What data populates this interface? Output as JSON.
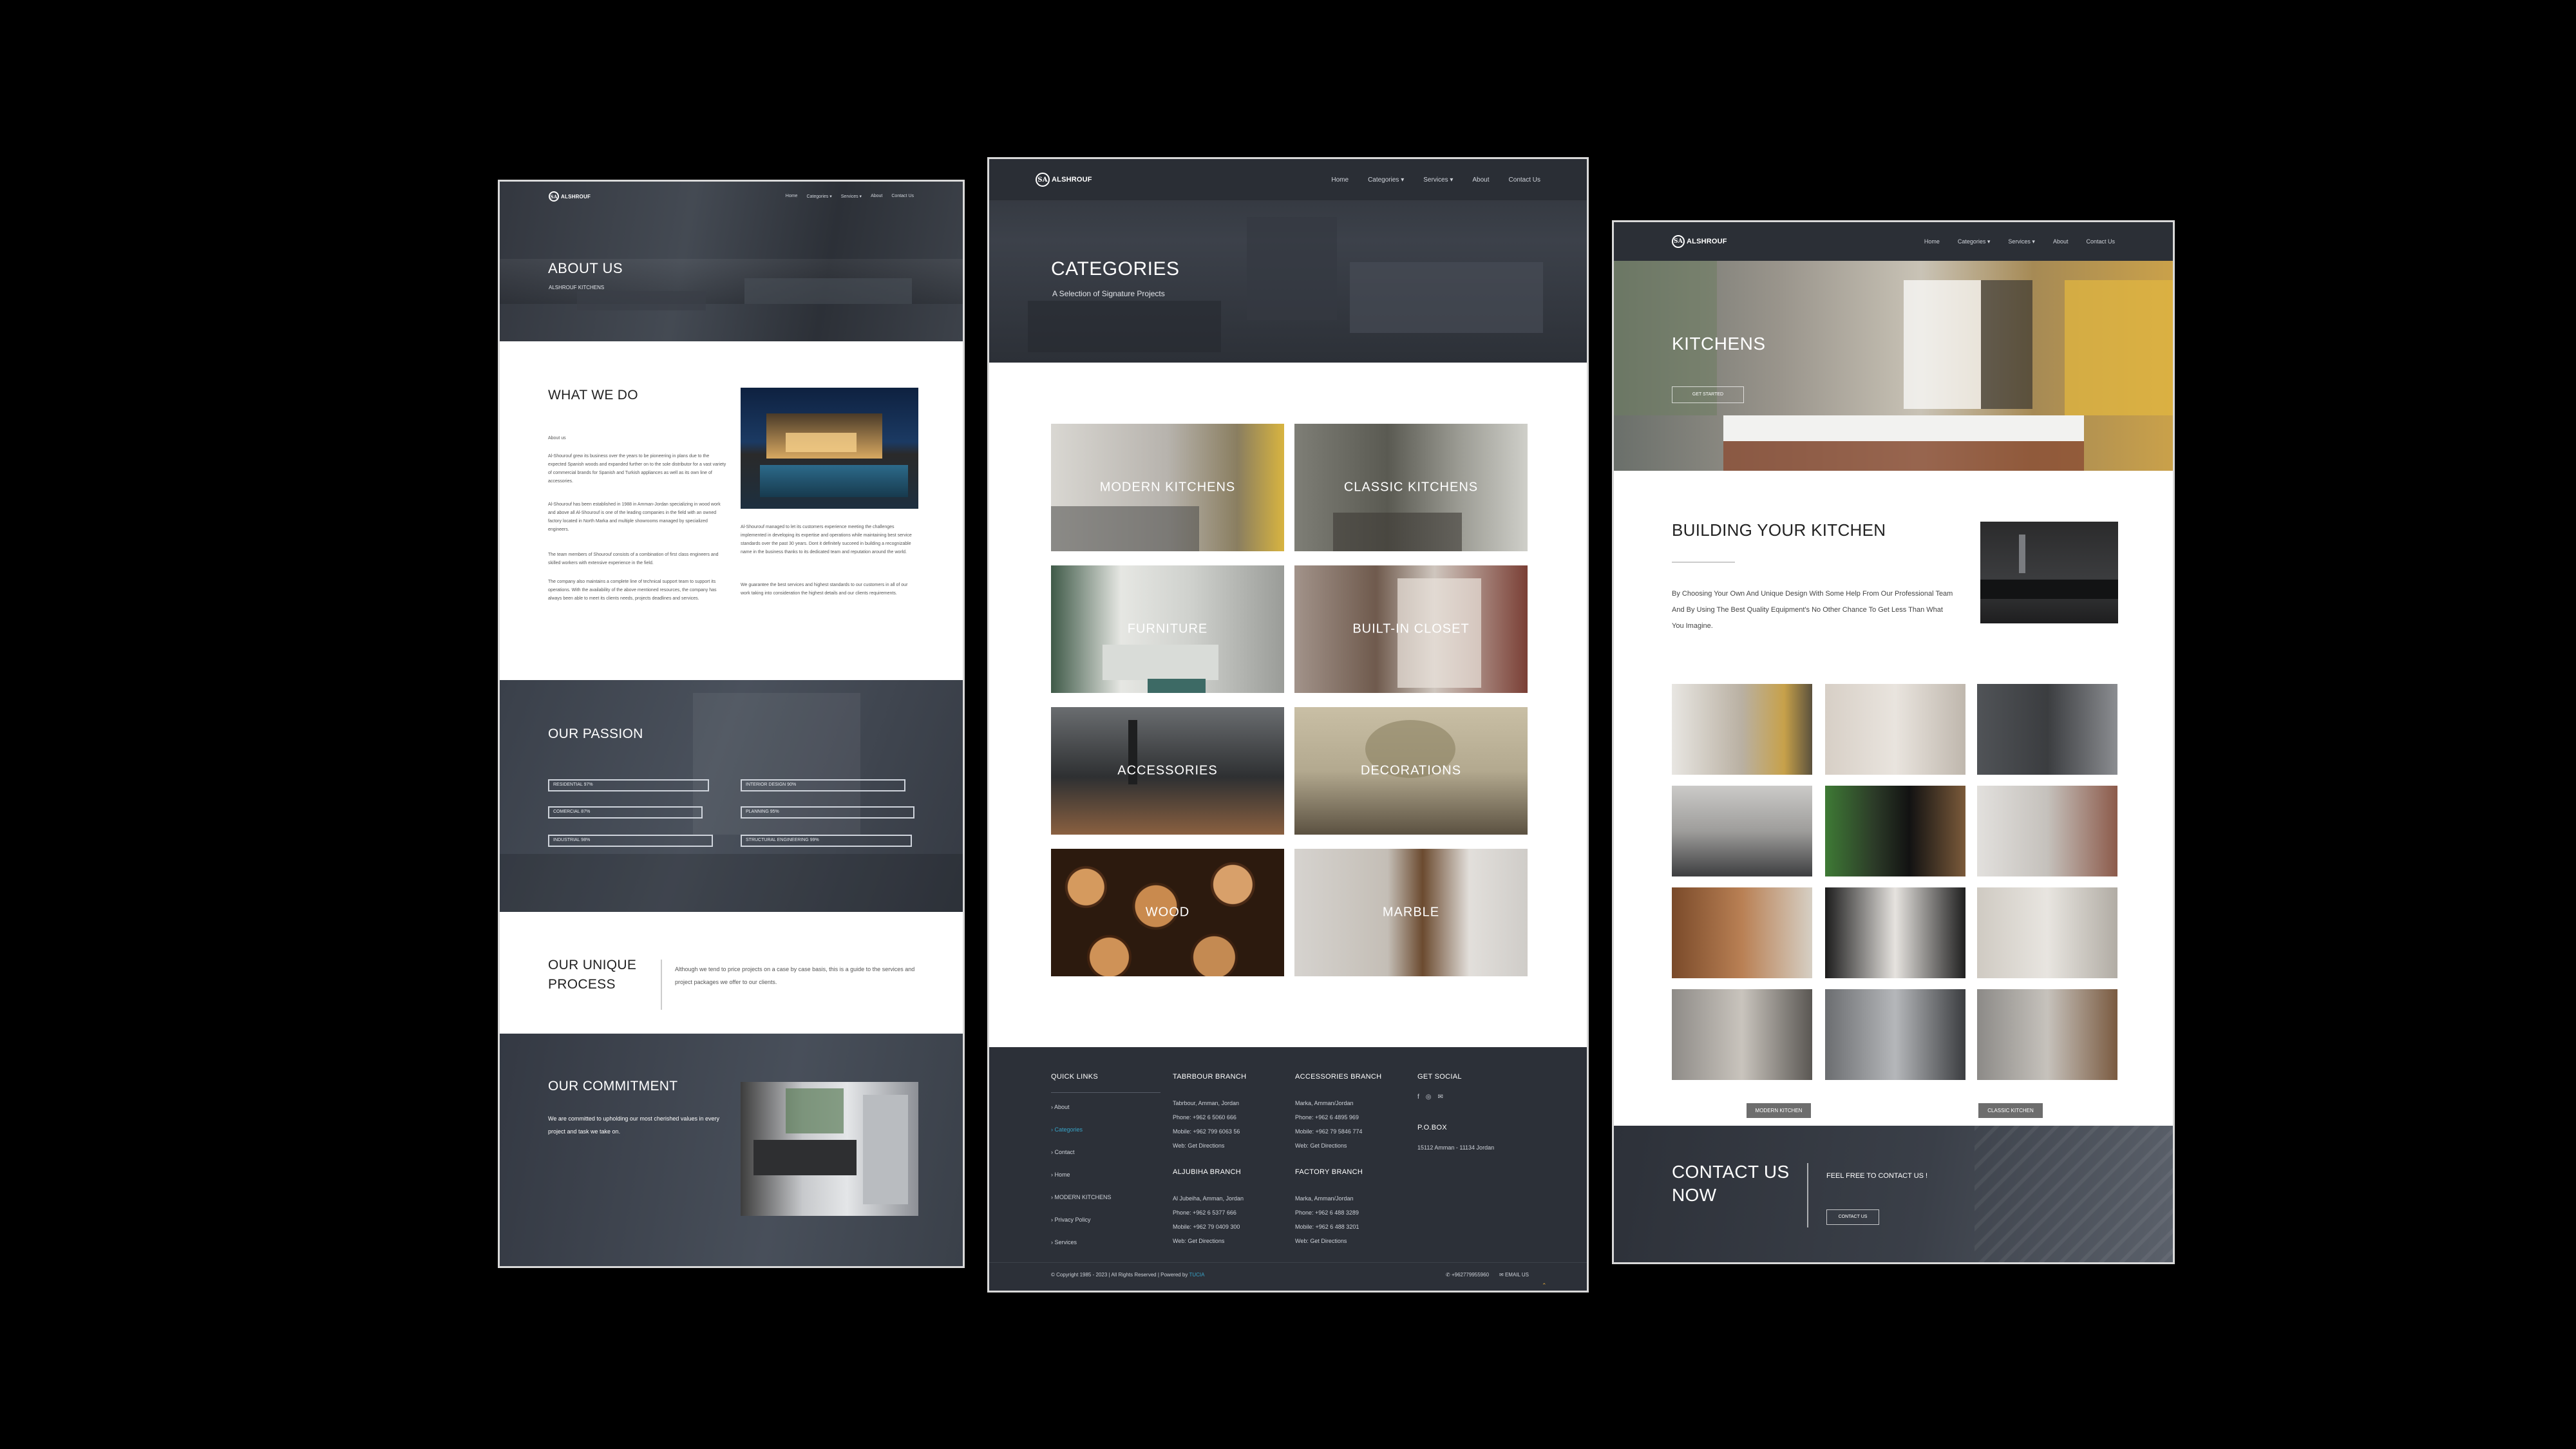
{
  "brand": {
    "logo_mark": "SA",
    "logo_text": "ALSHROUF"
  },
  "nav_small": [
    "Home",
    "Categories ▾",
    "Services ▾",
    "About",
    "Contact Us"
  ],
  "about_page": {
    "hero_title": "ABOUT US",
    "hero_sub": "ALSHROUF KITCHENS",
    "what_we_do": "WHAT WE DO",
    "about_label": "About us",
    "para1": "Al-Shourouf grew its business over the years to be pioneering in plans due to the expected Spanish woods and expanded further on to the sole distributor for a vast variety of commercial brands for Spanish and Turkish appliances as well as its own line of accessories.",
    "para2": "Al-Shourouf has been established in 1988 in Amman-Jordan specializing in wood work and above all Al-Shourouf is one of the leading companies in the field with an owned factory located in North Marka and multiple showrooms managed by specialized engineers.",
    "para3": "The team members of Shourouf consists of a combination of first class engineers and skilled workers with extensive experience in the field.",
    "para4": "The company also maintains a complete line of technical support team to support its operations. With the availability of the above mentioned resources, the company has always been able to meet its clients needs, projects deadlines and services.",
    "para5": "Al-Shourouf managed to let its customers experience meeting the challenges implemented in developing its expertise and operations while maintaining best service standards over the past 30 years. Dont it definitely succeed in building a recognizable name in the business thanks to its dedicated team and reputation around the world.",
    "para6": "We guarantee the best services and highest standards to our customers in all of our work taking into consideration the highest details and our clients requirements.",
    "passion_title": "OUR PASSION",
    "passion_bars": [
      {
        "label": "RESIDENTIAL 97%",
        "value": 97
      },
      {
        "label": "INTERIOR DESIGN 90%",
        "value": 90
      },
      {
        "label": "COMERCIAL 87%",
        "value": 87
      },
      {
        "label": "PLANNING 95%",
        "value": 95
      },
      {
        "label": "INDUSTRIAL 98%",
        "value": 98
      },
      {
        "label": "STRUCTURAL ENGINEERING 99%",
        "value": 99
      }
    ],
    "unique_title_1": "OUR UNIQUE",
    "unique_title_2": "PROCESS",
    "unique_text": "Although we tend to price projects on a case by case basis, this is a guide to the services and project packages we offer to our clients.",
    "commitment_title": "OUR COMMITMENT",
    "commitment_text": "We are committed to upholding our most cherished values in every project and task we take on."
  },
  "categories_page": {
    "hero_title": "CATEGORIES",
    "hero_sub": "A Selection of Signature Projects",
    "tiles": [
      "MODERN KITCHENS",
      "CLASSIC KITCHENS",
      "FURNITURE",
      "BUILT-IN CLOSET",
      "ACCESSORIES",
      "DECORATIONS",
      "WOOD",
      "MARBLE"
    ],
    "footer": {
      "quick_links_title": "QUICK LINKS",
      "quick_links": [
        "About",
        "Categories",
        "Contact",
        "Home",
        "MODERN KITCHENS",
        "Privacy Policy",
        "Services"
      ],
      "tabrbour": {
        "title": "TABRBOUR BRANCH",
        "lines": [
          "Tabrbour, Amman, Jordan",
          "Phone: +962 6 5060 666",
          "Mobile: +962 799 6063 56",
          "Web: Get Directions"
        ]
      },
      "accessories": {
        "title": "ACCESSORIES BRANCH",
        "lines": [
          "Marka, Amman/Jordan",
          "Phone: +962 6 4895 969",
          "Mobile: +962 79 5846 774",
          "Web: Get Directions"
        ]
      },
      "aljubiha": {
        "title": "ALJUBIHA BRANCH",
        "lines": [
          "Al Jubeiha, Amman, Jordan",
          "Phone: +962 6 5377 666",
          "Mobile: +962 79 0409 300",
          "Web: Get Directions"
        ]
      },
      "factory": {
        "title": "FACTORY BRANCH",
        "lines": [
          "Marka, Amman/Jordan",
          "Phone: +962 6 488 3289",
          "Mobile: +962 6 488 3201",
          "Web: Get Directions"
        ]
      },
      "social_title": "GET SOCIAL",
      "social_icons": [
        "f",
        "◎",
        "✉"
      ],
      "pobox_title": "P.O.BOX",
      "pobox": "15112 Amman - 11134 Jordan",
      "copyright": "© Copyright 1985 - 2023 |   All Rights Reserved   |   Powered by",
      "powered_by": "TUCIA",
      "phone": "+962779955960",
      "email": "EMAIL US"
    }
  },
  "kitchens_page": {
    "hero_title": "KITCHENS",
    "hero_btn": "GET STARTED",
    "building_title": "BUILDING YOUR KITCHEN",
    "building_text": "By Choosing Your Own And Unique Design With Some Help From Our Professional Team And By Using The Best Quality Equipment's No Other Chance To Get Less Than What You Imagine.",
    "btn_modern": "MODERN KITCHEN",
    "btn_classic": "CLASSIC KITCHEN",
    "contact_title_1": "CONTACT US",
    "contact_title_2": "NOW",
    "contact_text": "FEEL FREE TO CONTACT US !",
    "contact_btn": "CONTACT US"
  },
  "colors": {
    "nav": "#2b2f36",
    "footer": "#2c3038",
    "accent_link": "#37a2c6"
  }
}
